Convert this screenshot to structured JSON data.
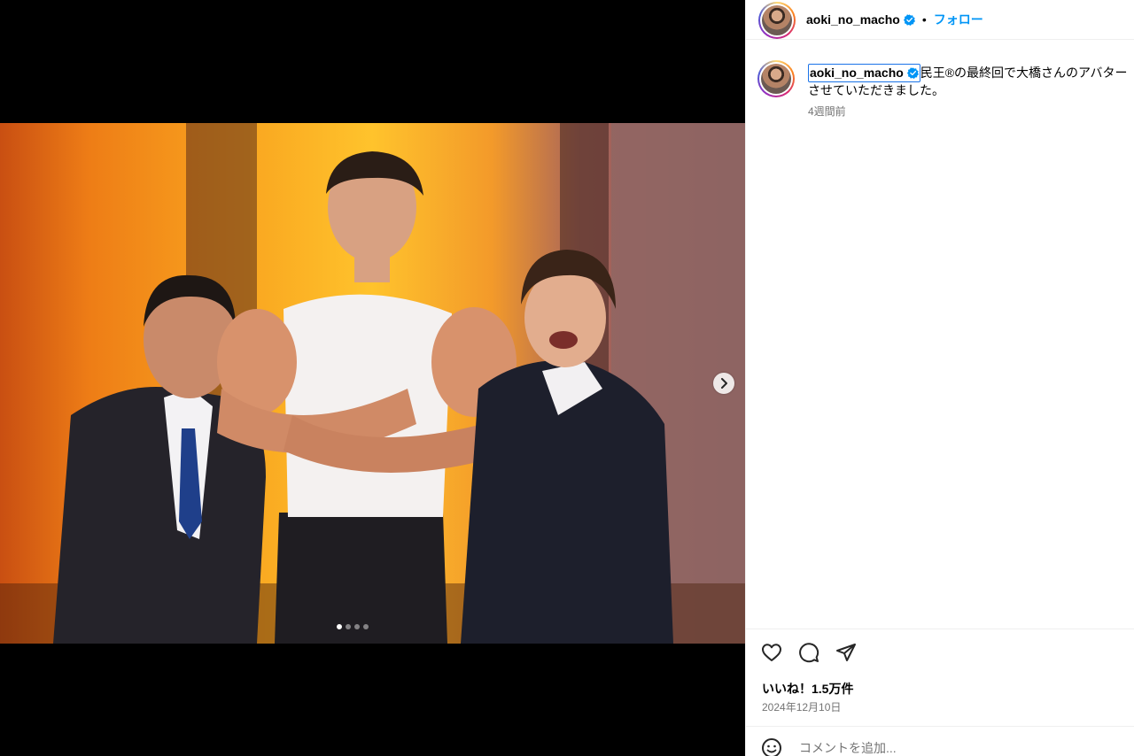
{
  "post": {
    "username": "aoki_no_macho",
    "follow_label": "フォロー",
    "separator": "•",
    "caption": {
      "username": "aoki_no_macho",
      "text": "民王®の最終回で大橋さんのアバター\nさせていただきました。",
      "time_ago": "4週間前"
    },
    "likes": "いいね！1.5万件",
    "date": "2024年12月10日",
    "comment_placeholder": "コメントを追加...",
    "carousel": {
      "slide_count": 4,
      "active_index": 0
    }
  },
  "colors": {
    "accent": "#0095f6",
    "verified": "#0095f6",
    "media_background": "#000000",
    "secondary_text": "#737373"
  },
  "icons": {
    "verified": "verified-badge-icon",
    "like": "heart-icon",
    "comment": "comment-icon",
    "share": "share-icon",
    "emoji": "emoji-icon",
    "next": "chevron-right-icon"
  }
}
